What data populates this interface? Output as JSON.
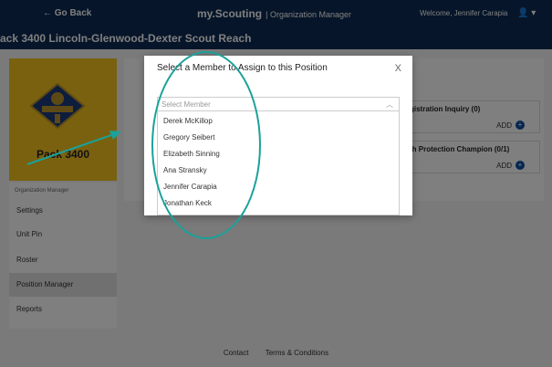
{
  "topbar": {
    "go_back": "← Go Back",
    "brand": "my.Scouting",
    "brand_sub": "| Organization Manager",
    "welcome": "Welcome, Jennifer Carapia",
    "user_icon": "user-icon"
  },
  "title": "ack 3400 Lincoln-Glenwood-Dexter Scout Reach",
  "unit": {
    "name": "Pack 3400",
    "logo_icon": "cub-scout-logo"
  },
  "sidebar": {
    "section_label": "Organization Manager",
    "items": [
      {
        "label": "Settings"
      },
      {
        "label": "Unit Pin"
      },
      {
        "label": "Roster"
      },
      {
        "label": "Position Manager"
      },
      {
        "label": "Reports"
      }
    ]
  },
  "cards": [
    {
      "label": "gistration Inquiry (0)",
      "add": "ADD"
    },
    {
      "label": "th Protection Champion (0/1)",
      "add": "ADD"
    }
  ],
  "modal": {
    "title": "Select a Member to Assign to this Position",
    "close": "X",
    "select_placeholder": "Select Member",
    "options": [
      "Derek McKillop",
      "Gregory Seibert",
      "Elizabeth Sinning",
      "Ana Stransky",
      "Jennifer Carapia",
      "Jonathan Keck"
    ]
  },
  "footer": {
    "contact": "Contact",
    "terms": "Terms & Conditions"
  },
  "colors": {
    "navy": "#0d2a52",
    "pack_yellow": "#f5c31e",
    "annotation_teal": "#1aa19a",
    "accent_blue": "#0d4fa0"
  }
}
